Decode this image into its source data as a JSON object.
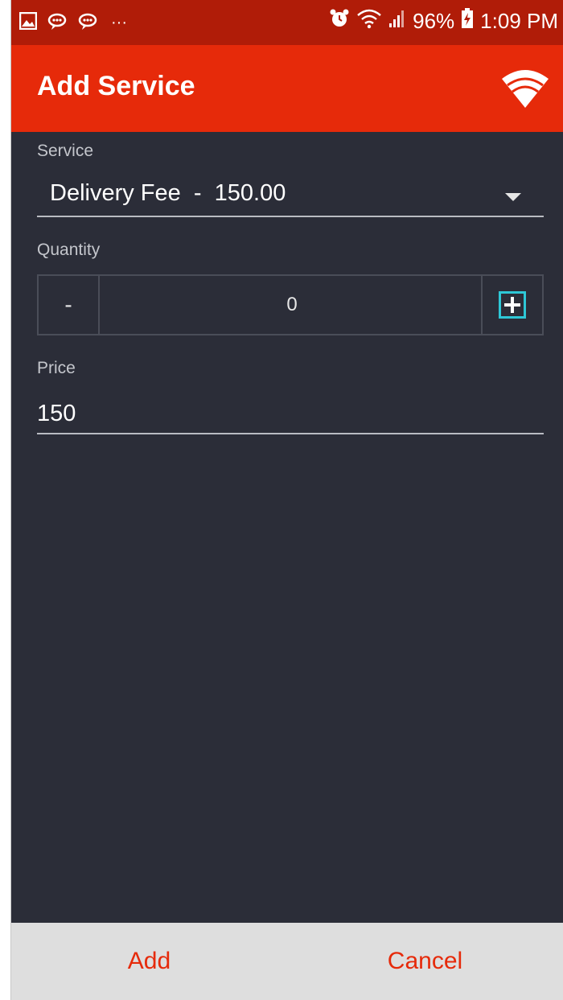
{
  "status_bar": {
    "battery_percent": "96%",
    "time": "1:09 PM",
    "more_indicator": "···",
    "icons": [
      "gallery-icon",
      "chat-bubble-icon",
      "chat-bubble-icon",
      "alarm-icon",
      "wifi-icon",
      "signal-icon",
      "battery-charging-icon"
    ]
  },
  "app_bar": {
    "title": "Add Service",
    "icon": "wifi-icon"
  },
  "form": {
    "service": {
      "label": "Service",
      "value": "Delivery Fee  -  150.00"
    },
    "quantity": {
      "label": "Quantity",
      "minus_label": "-",
      "value": "0"
    },
    "price": {
      "label": "Price",
      "value": "150"
    }
  },
  "actions": {
    "add_label": "Add",
    "cancel_label": "Cancel"
  },
  "colors": {
    "status_bar": "#b01c08",
    "app_bar": "#e62a0a",
    "background": "#2b2d38",
    "accent": "#e62a0a",
    "stepper_focus": "#2ec7d6",
    "bottom_bar": "#dedede"
  }
}
